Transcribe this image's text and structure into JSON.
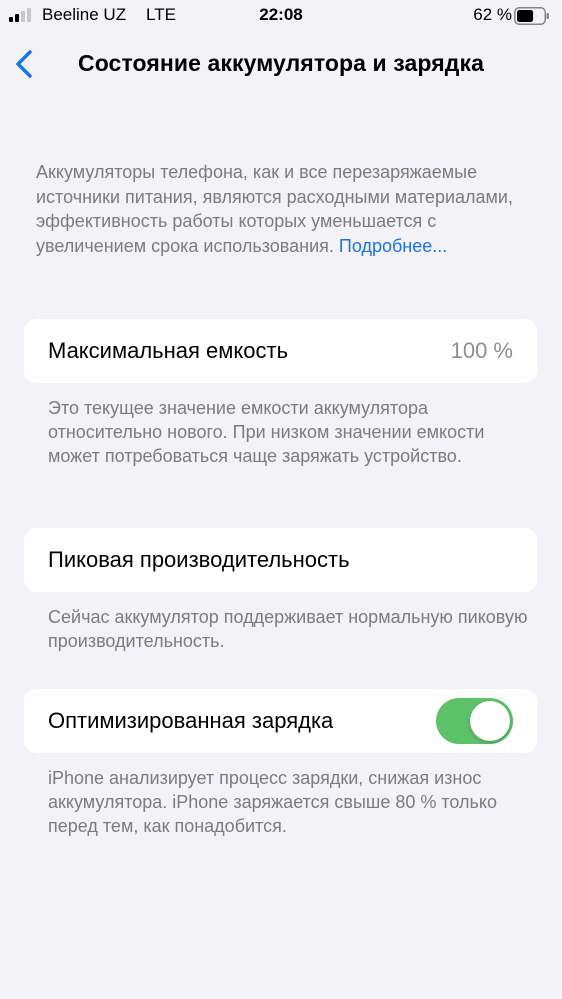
{
  "status_bar": {
    "carrier": "Beeline UZ",
    "network": "LTE",
    "time": "22:08",
    "battery_percent": "62 %",
    "battery_level": 0.62
  },
  "nav": {
    "back_icon": "chevron-left-icon",
    "title": "Состояние аккумулятора и зарядка"
  },
  "intro": {
    "text": "Аккумуляторы телефона, как и все перезаряжаемые источники питания, являются расходными материалами, эффективность работы которых уменьшается с увеличением срока использования.",
    "link": "Подробнее..."
  },
  "max_capacity": {
    "label": "Максимальная емкость",
    "value": "100 %",
    "footnote": "Это текущее значение емкости аккумулятора относительно нового. При низком значении емкости может потребоваться чаще заряжать устройство."
  },
  "peak_performance": {
    "label": "Пиковая производительность",
    "footnote": "Сейчас аккумулятор поддерживает нормальную пиковую производительность."
  },
  "optimized_charging": {
    "label": "Оптимизированная зарядка",
    "enabled": true,
    "footnote": "iPhone анализирует процесс зарядки, снижая износ аккумулятора. iPhone заряжается свыше 80 % только перед тем, как понадобится."
  },
  "colors": {
    "accent": "#1a73e8",
    "toggle_on": "#5ec26a",
    "background": "#f2f2f7"
  }
}
